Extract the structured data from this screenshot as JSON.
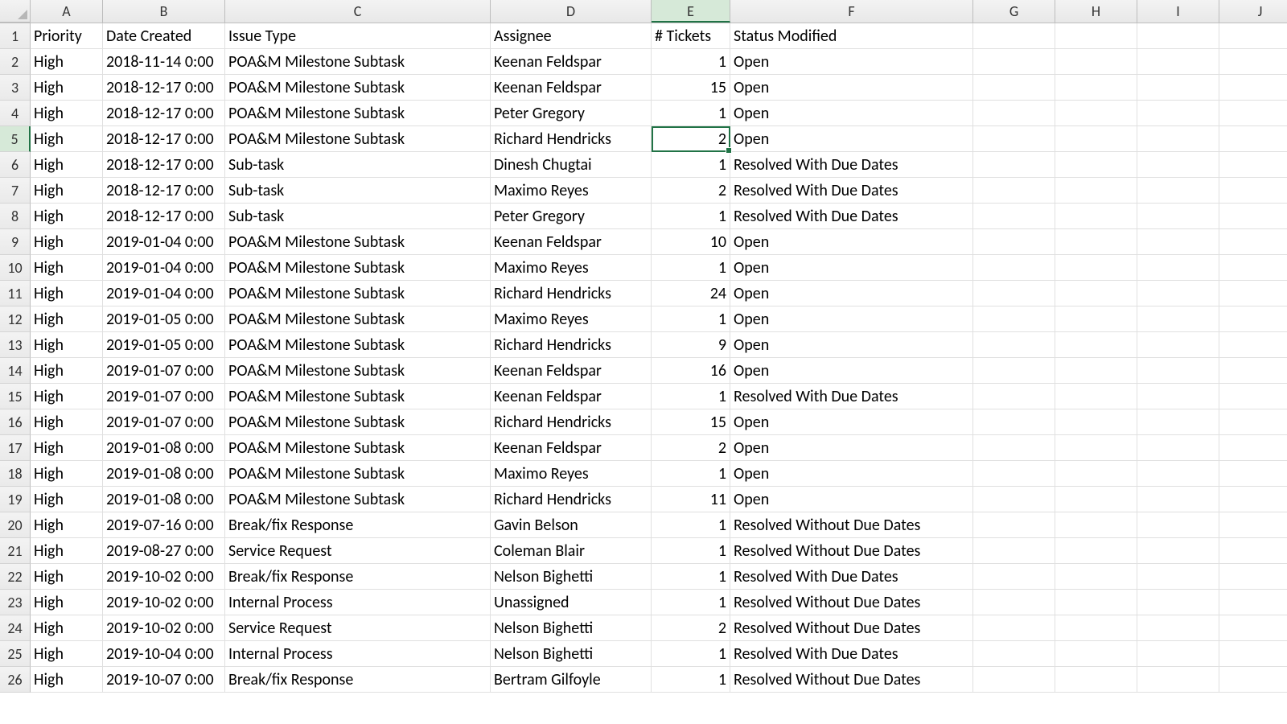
{
  "columns": [
    "A",
    "B",
    "C",
    "D",
    "E",
    "F",
    "G",
    "H",
    "I",
    "J"
  ],
  "selectedCell": {
    "row": 5,
    "col": "E"
  },
  "headers": {
    "A": "Priority",
    "B": "Date Created",
    "C": "Issue Type",
    "D": "Assignee",
    "E": "# Tickets",
    "F": "Status Modified"
  },
  "chart_data": {
    "type": "table",
    "columns": [
      "Priority",
      "Date Created",
      "Issue Type",
      "Assignee",
      "# Tickets",
      "Status Modified"
    ],
    "rows": [
      [
        "High",
        "2018-11-14 0:00",
        "POA&M Milestone Subtask",
        "Keenan Feldspar",
        1,
        "Open"
      ],
      [
        "High",
        "2018-12-17 0:00",
        "POA&M Milestone Subtask",
        "Keenan Feldspar",
        15,
        "Open"
      ],
      [
        "High",
        "2018-12-17 0:00",
        "POA&M Milestone Subtask",
        "Peter Gregory",
        1,
        "Open"
      ],
      [
        "High",
        "2018-12-17 0:00",
        "POA&M Milestone Subtask",
        "Richard Hendricks",
        2,
        "Open"
      ],
      [
        "High",
        "2018-12-17 0:00",
        "Sub-task",
        "Dinesh Chugtai",
        1,
        "Resolved With Due Dates"
      ],
      [
        "High",
        "2018-12-17 0:00",
        "Sub-task",
        "Maximo Reyes",
        2,
        "Resolved With Due Dates"
      ],
      [
        "High",
        "2018-12-17 0:00",
        "Sub-task",
        "Peter Gregory",
        1,
        "Resolved With Due Dates"
      ],
      [
        "High",
        "2019-01-04 0:00",
        "POA&M Milestone Subtask",
        "Keenan Feldspar",
        10,
        "Open"
      ],
      [
        "High",
        "2019-01-04 0:00",
        "POA&M Milestone Subtask",
        "Maximo Reyes",
        1,
        "Open"
      ],
      [
        "High",
        "2019-01-04 0:00",
        "POA&M Milestone Subtask",
        "Richard Hendricks",
        24,
        "Open"
      ],
      [
        "High",
        "2019-01-05 0:00",
        "POA&M Milestone Subtask",
        "Maximo Reyes",
        1,
        "Open"
      ],
      [
        "High",
        "2019-01-05 0:00",
        "POA&M Milestone Subtask",
        "Richard Hendricks",
        9,
        "Open"
      ],
      [
        "High",
        "2019-01-07 0:00",
        "POA&M Milestone Subtask",
        "Keenan Feldspar",
        16,
        "Open"
      ],
      [
        "High",
        "2019-01-07 0:00",
        "POA&M Milestone Subtask",
        "Keenan Feldspar",
        1,
        "Resolved With Due Dates"
      ],
      [
        "High",
        "2019-01-07 0:00",
        "POA&M Milestone Subtask",
        "Richard Hendricks",
        15,
        "Open"
      ],
      [
        "High",
        "2019-01-08 0:00",
        "POA&M Milestone Subtask",
        "Keenan Feldspar",
        2,
        "Open"
      ],
      [
        "High",
        "2019-01-08 0:00",
        "POA&M Milestone Subtask",
        "Maximo Reyes",
        1,
        "Open"
      ],
      [
        "High",
        "2019-01-08 0:00",
        "POA&M Milestone Subtask",
        "Richard Hendricks",
        11,
        "Open"
      ],
      [
        "High",
        "2019-07-16 0:00",
        "Break/fix Response",
        "Gavin Belson",
        1,
        "Resolved Without Due Dates"
      ],
      [
        "High",
        "2019-08-27 0:00",
        "Service Request",
        "Coleman Blair",
        1,
        "Resolved Without Due Dates"
      ],
      [
        "High",
        "2019-10-02 0:00",
        "Break/fix Response",
        "Nelson Bighetti",
        1,
        "Resolved With Due Dates"
      ],
      [
        "High",
        "2019-10-02 0:00",
        "Internal Process",
        "Unassigned",
        1,
        "Resolved Without Due Dates"
      ],
      [
        "High",
        "2019-10-02 0:00",
        "Service Request",
        "Nelson Bighetti",
        2,
        "Resolved Without Due Dates"
      ],
      [
        "High",
        "2019-10-04 0:00",
        "Internal Process",
        "Nelson Bighetti",
        1,
        "Resolved With Due Dates"
      ],
      [
        "High",
        "2019-10-07 0:00",
        "Break/fix Response",
        "Bertram Gilfoyle",
        1,
        "Resolved Without Due Dates"
      ]
    ]
  }
}
